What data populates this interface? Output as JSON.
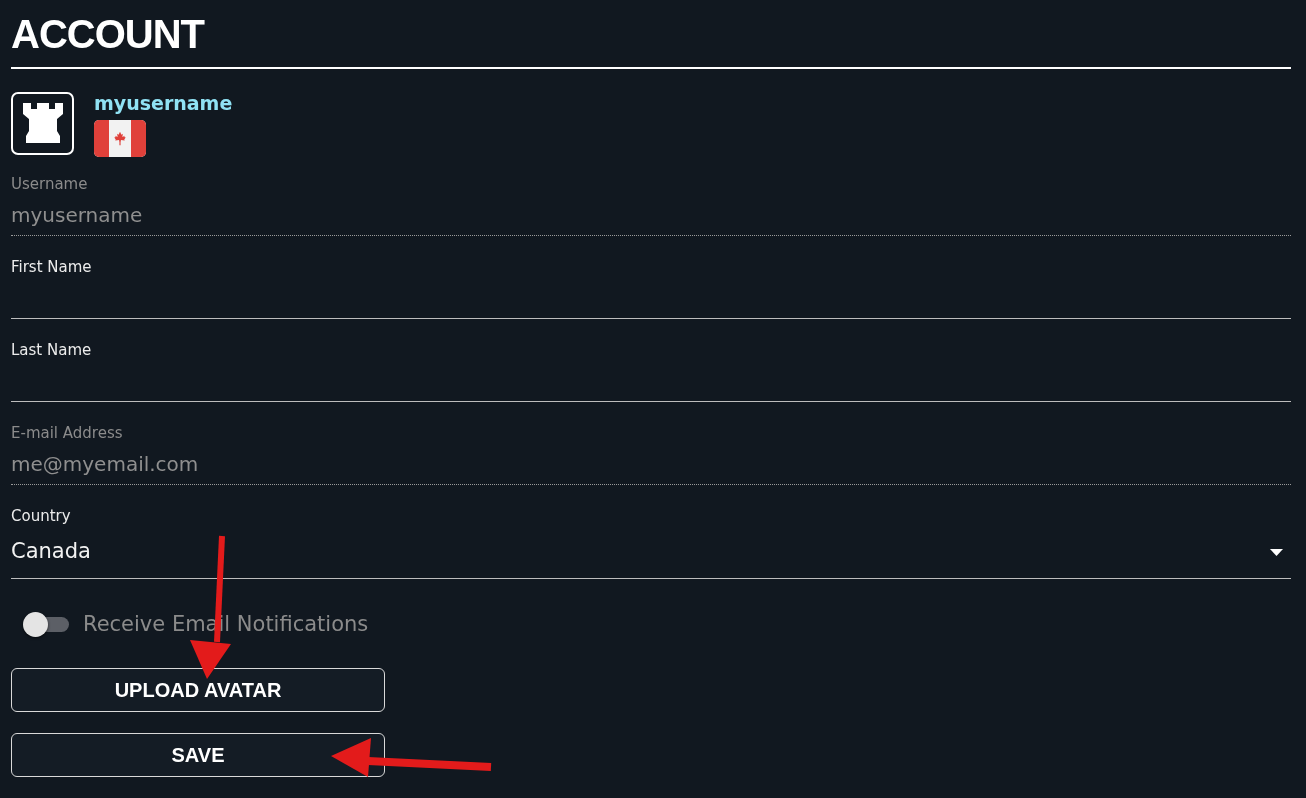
{
  "page": {
    "title": "ACCOUNT"
  },
  "profile": {
    "username": "myusername"
  },
  "fields": [
    {
      "kind": "text",
      "label": "Username",
      "value": "myusername",
      "disabled": true
    },
    {
      "kind": "text",
      "label": "First Name",
      "disabled": false
    },
    {
      "kind": "text",
      "label": "Last Name",
      "disabled": false
    },
    {
      "kind": "text",
      "label": "E-mail Address",
      "value": "me@myemail.com",
      "disabled": true
    },
    {
      "kind": "select",
      "label": "Country",
      "value": "Canada",
      "disabled": false
    }
  ],
  "notifications_toggle": {
    "label": "Receive Email Notifications",
    "on": false,
    "disabled": true
  },
  "buttons": [
    "UPLOAD AVATAR",
    "SAVE"
  ]
}
